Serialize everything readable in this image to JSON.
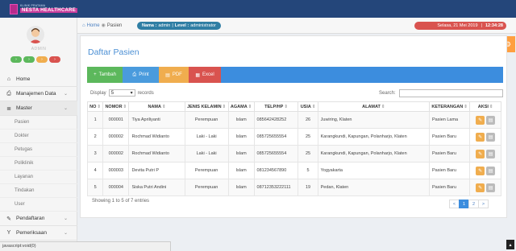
{
  "brand": {
    "small_text": "KLINIK PRATAMA",
    "big_text": "NESTA HEALTHCARE"
  },
  "sidebar": {
    "user_label": "ADMIN",
    "pills": [
      {
        "icon": "chevron-right-icon",
        "glyph": "›",
        "color": "#5cb85c"
      },
      {
        "icon": "chevron-right-icon",
        "glyph": "›",
        "color": "#5cb85c"
      },
      {
        "icon": "chevron-right-icon",
        "glyph": "›",
        "color": "#f0ad4e"
      },
      {
        "icon": "chevron-right-icon",
        "glyph": "›",
        "color": "#d9534f"
      }
    ],
    "menu": [
      {
        "label": "Home",
        "icon": "home-icon",
        "glyph": "⌂"
      },
      {
        "label": "Manajemen Data",
        "icon": "printer-icon",
        "glyph": "⎙"
      },
      {
        "label": "Master",
        "icon": "list-icon",
        "glyph": "≣"
      }
    ],
    "submenu": [
      "Pasien",
      "Dokter",
      "Petugas",
      "Poliklinik",
      "Layanan",
      "Tindakan",
      "User"
    ],
    "menu2": [
      {
        "label": "Pendaftaran",
        "icon": "edit-icon",
        "glyph": "✎"
      },
      {
        "label": "Pemeriksaan",
        "icon": "filter-icon",
        "glyph": "Y"
      }
    ]
  },
  "breadcrumb": {
    "home": "Home",
    "current": "Pasien"
  },
  "user_badge": {
    "name_label": "Nama :",
    "name": "admin",
    "level_label": "Level :",
    "level": "administrator"
  },
  "date_badge": {
    "date": "Selasa, 21 Mei 2019",
    "time": "12:34:28"
  },
  "page": {
    "title": "Daftar Pasien"
  },
  "toolbar": [
    {
      "label": "Tambah",
      "glyph": "+",
      "icon": "plus-icon",
      "color": "#5cb85c",
      "width": 44
    },
    {
      "label": "Print",
      "glyph": "⎙",
      "icon": "print-icon",
      "color": "#4a9bdd",
      "width": 45
    },
    {
      "label": "PDF",
      "glyph": "▤",
      "icon": "pdf-icon",
      "color": "#f0ad4e",
      "width": 37
    },
    {
      "label": "Excel",
      "glyph": "▦",
      "icon": "excel-icon",
      "color": "#d9534f",
      "width": 40
    }
  ],
  "display": {
    "label": "Display",
    "value": "5",
    "suffix": "records"
  },
  "search": {
    "label": "Search:",
    "value": ""
  },
  "table": {
    "headers": [
      "NO",
      "NOMOR",
      "NAMA",
      "JENIS KELAMIN",
      "AGAMA",
      "TELP/HP",
      "USIA",
      "ALAMAT",
      "KETERANGAN",
      "AKSI"
    ],
    "rows": [
      [
        "1",
        "000001",
        "Tiya Apriliyanti",
        "Perempuan",
        "Islam",
        "085642428252",
        "26",
        "Juwiring, Klaten",
        "Pasien Lama"
      ],
      [
        "2",
        "000002",
        "Rochmad Widianto",
        "Laki - Laki",
        "Islam",
        "085725655554",
        "25",
        "Karangkundi, Kapungan, Polanharjo, Klaten",
        "Pasien Baru"
      ],
      [
        "3",
        "000002",
        "Rochmad Widianto",
        "Laki - Laki",
        "Islam",
        "085725655554",
        "25",
        "Karangkundi, Kapungan, Polanharjo, Klaten",
        "Pasien Baru"
      ],
      [
        "4",
        "000003",
        "Devita Putri P",
        "Perempuan",
        "Islam",
        "081234567890",
        "5",
        "Yogyakarta",
        "Pasien Baru"
      ],
      [
        "5",
        "000004",
        "Siska Putri Andini",
        "Perempuan",
        "Islam",
        "08712353222111",
        "19",
        "Pedan, Klaten",
        "Pasien Baru"
      ]
    ]
  },
  "footer": {
    "showing": "Showing 1 to 5 of 7 entries"
  },
  "pagination": [
    "<",
    "1",
    "2",
    ">"
  ],
  "status_bar": "javascript:void(0)"
}
